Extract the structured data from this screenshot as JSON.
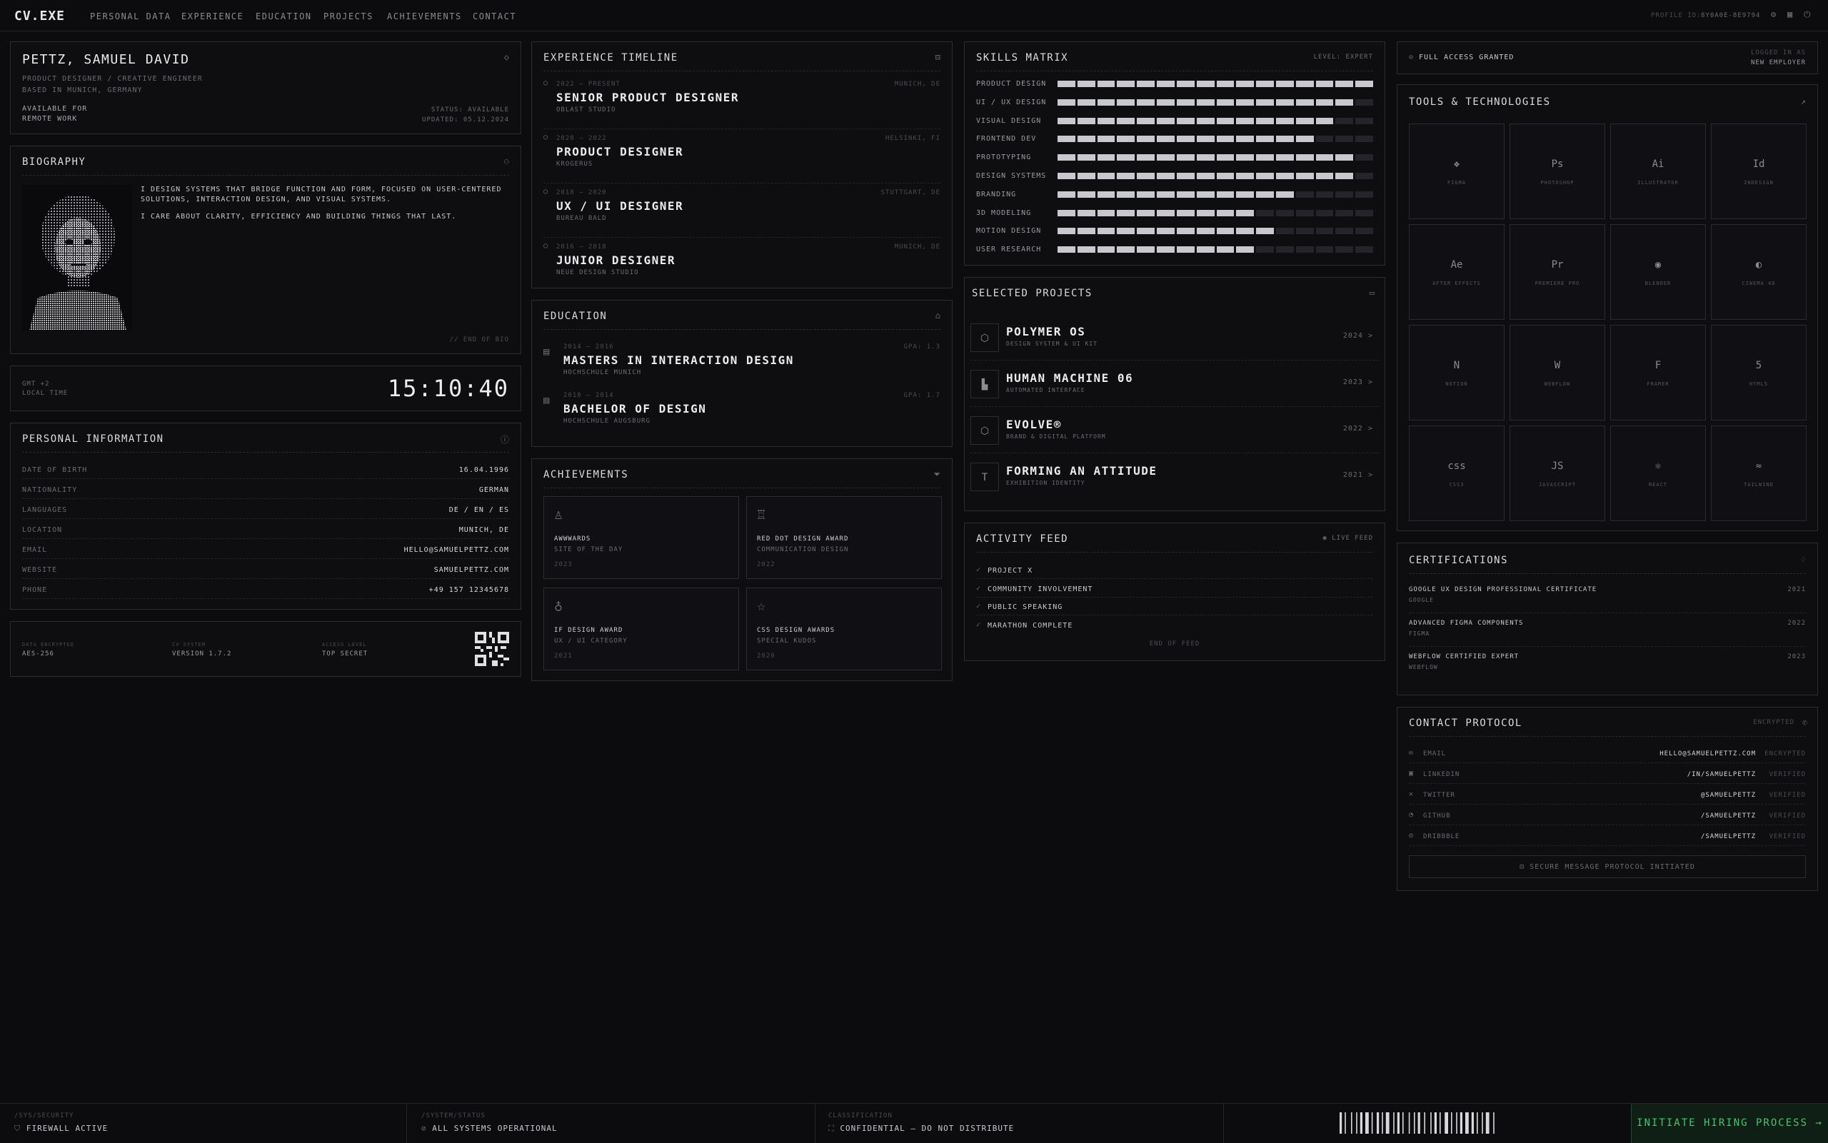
{
  "nav": {
    "logo": "CV.EXE",
    "items": [
      "PERSONAL DATA",
      "EXPERIENCE",
      "EDUCATION",
      "PROJECTS",
      "ACHIEVEMENTS",
      "CONTACT"
    ],
    "profile_id_label": "PROFILE ID:",
    "profile_id": "8Y0A0E-8E9794"
  },
  "profile": {
    "name": "PETTZ, SAMUEL DAVID",
    "role": "PRODUCT DESIGNER / CREATIVE ENGINEER",
    "based": "BASED IN MUNICH, GERMANY",
    "avail1": "AVAILABLE FOR",
    "avail2": "REMOTE WORK",
    "status": "STATUS: AVAILABLE",
    "updated": "UPDATED: 05.12.2024"
  },
  "bio": {
    "title": "BIOGRAPHY",
    "p1": "I DESIGN SYSTEMS THAT BRIDGE FUNCTION AND FORM, FOCUSED ON USER-CENTERED SOLUTIONS, INTERACTION DESIGN, AND VISUAL SYSTEMS.",
    "p2": "I CARE ABOUT CLARITY, EFFICIENCY AND BUILDING THINGS THAT LAST.",
    "end": "// END OF BIO"
  },
  "clock": {
    "tz": "GMT +2",
    "label": "LOCAL TIME",
    "time": "15:10:40"
  },
  "personal": {
    "title": "PERSONAL INFORMATION",
    "rows": [
      {
        "k": "DATE OF BIRTH",
        "v": "16.04.1996"
      },
      {
        "k": "NATIONALITY",
        "v": "GERMAN"
      },
      {
        "k": "LANGUAGES",
        "v": "DE / EN / ES"
      },
      {
        "k": "LOCATION",
        "v": "MUNICH, DE"
      },
      {
        "k": "EMAIL",
        "v": "HELLO@SAMUELPETTZ.COM"
      },
      {
        "k": "WEBSITE",
        "v": "SAMUELPETTZ.COM"
      },
      {
        "k": "PHONE",
        "v": "+49 157 12345678"
      }
    ]
  },
  "sysinfo": {
    "c1k": "DATA ENCRYPTED",
    "c1v": "AES-256",
    "c2k": "CV SYSTEM",
    "c2v": "VERSION 1.7.2",
    "c3k": "ACCESS LEVEL",
    "c3v": "TOP SECRET"
  },
  "experience": {
    "title": "EXPERIENCE TIMELINE",
    "items": [
      {
        "dates": "2022 — PRESENT",
        "loc": "MUNICH, DE",
        "role": "SENIOR PRODUCT DESIGNER",
        "co": "OBLAST STUDIO"
      },
      {
        "dates": "2020 — 2022",
        "loc": "HELSINKI, FI",
        "role": "PRODUCT DESIGNER",
        "co": "KROGERUS"
      },
      {
        "dates": "2018 — 2020",
        "loc": "STUTTGART, DE",
        "role": "UX / UI DESIGNER",
        "co": "BUREAU BALD"
      },
      {
        "dates": "2016 — 2018",
        "loc": "MUNICH, DE",
        "role": "JUNIOR DESIGNER",
        "co": "NEUE DESIGN STUDIO"
      }
    ]
  },
  "education": {
    "title": "EDUCATION",
    "items": [
      {
        "dates": "2014 — 2016",
        "gpa": "GPA: 1.3",
        "deg": "MASTERS IN INTERACTION DESIGN",
        "school": "HOCHSCHULE MUNICH"
      },
      {
        "dates": "2010 — 2014",
        "gpa": "GPA: 1.7",
        "deg": "BACHELOR OF DESIGN",
        "school": "HOCHSCHULE AUGSBURG"
      }
    ]
  },
  "achievements": {
    "title": "ACHIEVEMENTS",
    "items": [
      {
        "name": "AWWWARDS",
        "sub": "SITE OF THE DAY",
        "year": "2023"
      },
      {
        "name": "RED DOT DESIGN AWARD",
        "sub": "COMMUNICATION DESIGN",
        "year": "2022"
      },
      {
        "name": "IF DESIGN AWARD",
        "sub": "UX / UI CATEGORY",
        "year": "2021"
      },
      {
        "name": "CSS DESIGN AWARDS",
        "sub": "SPECIAL KUDOS",
        "year": "2020"
      }
    ]
  },
  "skills": {
    "title": "SKILLS MATRIX",
    "level": "LEVEL: EXPERT",
    "segments": 16,
    "rows": [
      {
        "name": "PRODUCT DESIGN",
        "level": 16
      },
      {
        "name": "UI / UX DESIGN",
        "level": 15
      },
      {
        "name": "VISUAL DESIGN",
        "level": 14
      },
      {
        "name": "FRONTEND DEV",
        "level": 13
      },
      {
        "name": "PROTOTYPING",
        "level": 15
      },
      {
        "name": "DESIGN SYSTEMS",
        "level": 15
      },
      {
        "name": "BRANDING",
        "level": 12
      },
      {
        "name": "3D MODELING",
        "level": 10
      },
      {
        "name": "MOTION DESIGN",
        "level": 11
      },
      {
        "name": "USER RESEARCH",
        "level": 10
      }
    ]
  },
  "projects": {
    "title": "SELECTED PROJECTS",
    "items": [
      {
        "name": "POLYMER OS",
        "sub": "DESIGN SYSTEM & UI KIT",
        "year": "2024 >",
        "icon": "cube-icon",
        "glyph": "⬡"
      },
      {
        "name": "HUMAN MACHINE 06",
        "sub": "AUTOMATED INTERFACE",
        "year": "2023 >",
        "icon": "chart-icon",
        "glyph": "▙"
      },
      {
        "name": "EVOLVE®",
        "sub": "BRAND & DIGITAL PLATFORM",
        "year": "2022 >",
        "icon": "hexagon-icon",
        "glyph": "⬡"
      },
      {
        "name": "FORMING AN ATTITUDE",
        "sub": "EXHIBITION IDENTITY",
        "year": "2021 >",
        "icon": "type-icon",
        "glyph": "T"
      }
    ]
  },
  "activity": {
    "title": "ACTIVITY FEED",
    "live": "LIVE FEED",
    "items": [
      "PROJECT X",
      "COMMUNITY INVOLVEMENT",
      "PUBLIC SPEAKING",
      "MARATHON COMPLETE"
    ],
    "end": "END OF FEED"
  },
  "access": {
    "granted": "FULL ACCESS GRANTED",
    "logged1": "LOGGED IN AS",
    "logged2": "NEW EMPLOYER"
  },
  "tools": {
    "title": "TOOLS & TECHNOLOGIES",
    "items": [
      {
        "name": "FIGMA",
        "glyph": "❖",
        "icon": "figma-icon"
      },
      {
        "name": "PHOTOSHOP",
        "glyph": "Ps",
        "icon": "photoshop-icon"
      },
      {
        "name": "ILLUSTRATOR",
        "glyph": "Ai",
        "icon": "illustrator-icon"
      },
      {
        "name": "INDESIGN",
        "glyph": "Id",
        "icon": "indesign-icon"
      },
      {
        "name": "AFTER EFFECTS",
        "glyph": "Ae",
        "icon": "after-effects-icon"
      },
      {
        "name": "PREMIERE PRO",
        "glyph": "Pr",
        "icon": "premiere-icon"
      },
      {
        "name": "BLENDER",
        "glyph": "◉",
        "icon": "blender-icon"
      },
      {
        "name": "CINEMA 4D",
        "glyph": "◐",
        "icon": "cinema4d-icon"
      },
      {
        "name": "NOTION",
        "glyph": "N",
        "icon": "notion-icon"
      },
      {
        "name": "WEBFLOW",
        "glyph": "W",
        "icon": "webflow-icon"
      },
      {
        "name": "FRAMER",
        "glyph": "F",
        "icon": "framer-icon"
      },
      {
        "name": "HTML5",
        "glyph": "5",
        "icon": "html5-icon"
      },
      {
        "name": "CSS3",
        "glyph": "css",
        "icon": "css3-icon"
      },
      {
        "name": "JAVASCRIPT",
        "glyph": "JS",
        "icon": "javascript-icon"
      },
      {
        "name": "REACT",
        "glyph": "⚛",
        "icon": "react-icon"
      },
      {
        "name": "TAILWIND",
        "glyph": "≈",
        "icon": "tailwind-icon"
      }
    ]
  },
  "certs": {
    "title": "CERTIFICATIONS",
    "items": [
      {
        "name": "GOOGLE UX DESIGN PROFESSIONAL CERTIFICATE",
        "org": "GOOGLE",
        "year": "2021"
      },
      {
        "name": "ADVANCED FIGMA COMPONENTS",
        "org": "FIGMA",
        "year": "2022"
      },
      {
        "name": "WEBFLOW CERTIFIED EXPERT",
        "org": "WEBFLOW",
        "year": "2023"
      }
    ]
  },
  "contact": {
    "title": "CONTACT PROTOCOL",
    "enc": "ENCRYPTED",
    "rows": [
      {
        "k": "EMAIL",
        "v": "HELLO@SAMUELPETTZ.COM",
        "s": "ENCRYPTED",
        "icon": "mail-icon",
        "glyph": "✉"
      },
      {
        "k": "LINKEDIN",
        "v": "/IN/SAMUELPETTZ",
        "s": "VERIFIED",
        "icon": "linkedin-icon",
        "glyph": "▣"
      },
      {
        "k": "TWITTER",
        "v": "@SAMUELPETTZ",
        "s": "VERIFIED",
        "icon": "twitter-x-icon",
        "glyph": "✕"
      },
      {
        "k": "GITHUB",
        "v": "/SAMUELPETTZ",
        "s": "VERIFIED",
        "icon": "github-icon",
        "glyph": "◔"
      },
      {
        "k": "DRIBBBLE",
        "v": "/SAMUELPETTZ",
        "s": "VERIFIED",
        "icon": "dribbble-icon",
        "glyph": "◎"
      }
    ],
    "secure": "SECURE MESSAGE PROTOCOL INITIATED"
  },
  "footer": {
    "c1k": "/SYS/SECURITY",
    "c1v": "FIREWALL ACTIVE",
    "c2k": "/SYSTEM/STATUS",
    "c2v": "ALL SYSTEMS OPERATIONAL",
    "c3k": "CLASSIFICATION",
    "c3v": "CONFIDENTIAL — DO NOT DISTRIBUTE",
    "cta": "INITIATE HIRING PROCESS →"
  }
}
